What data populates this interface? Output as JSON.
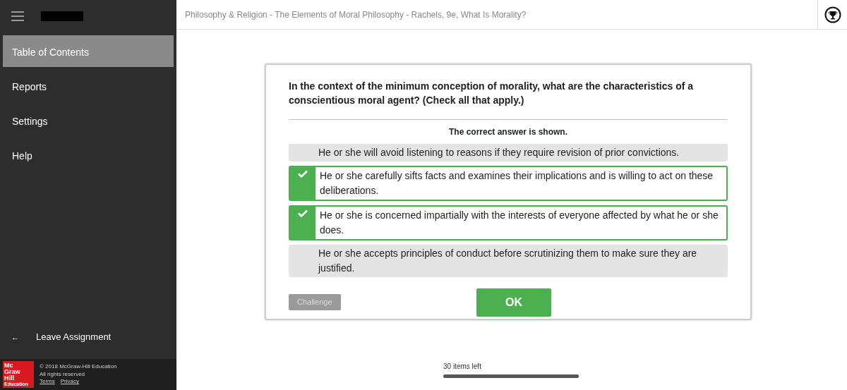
{
  "sidebar": {
    "items": [
      {
        "label": "Table of Contents",
        "selected": true
      },
      {
        "label": "Reports",
        "selected": false
      },
      {
        "label": "Settings",
        "selected": false
      },
      {
        "label": "Help",
        "selected": false
      }
    ],
    "leave": {
      "icon": "←",
      "label": "Leave Assignment"
    },
    "footer": {
      "logo": [
        "Mc",
        "Graw",
        "Hill",
        "Education"
      ],
      "copyright": "© 2018 McGraw-Hill Education",
      "rights": "All rights reserved",
      "links": [
        "Terms",
        "Privacy"
      ]
    }
  },
  "header": {
    "title": "Philosophy & Religion - The Elements of Moral Philosophy - Rachels, 9e, What Is Morality?"
  },
  "question": {
    "prompt": "In the context of the minimum conception of morality, what are the characteristics of a conscientious moral agent? (Check all that apply.)",
    "notice": "The correct answer is shown.",
    "options": [
      {
        "text": "He or she will avoid listening to reasons if they require revision of prior convictions.",
        "checked": false
      },
      {
        "text": "He or she carefully sifts facts and examines their implications and is willing to act on these deliberations.",
        "checked": true
      },
      {
        "text": "He or she is concerned impartially with the interests of everyone affected by what he or she does.",
        "checked": true
      },
      {
        "text": "He or she accepts principles of conduct before scrutinizing them to make sure they are justified.",
        "checked": false
      }
    ],
    "challenge": "Challenge",
    "ok": "OK"
  },
  "progress": {
    "label": "30 items left",
    "level": 1
  }
}
